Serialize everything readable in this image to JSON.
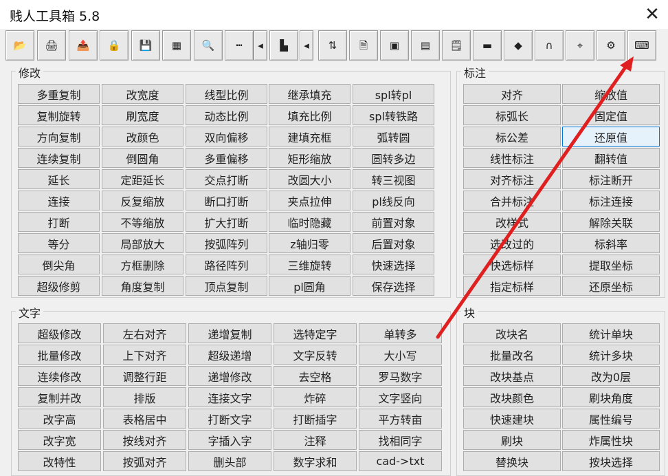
{
  "window": {
    "title": "贱人工具箱 5.8",
    "close_glyph": "✕"
  },
  "toolbar": {
    "icons": [
      "open-folder-icon",
      "printer-icon",
      "export-icon",
      "lock-icon",
      "save-icon",
      "table-icon",
      "magnifier-icon",
      "dashed-line-icon",
      "arrow-left-icon",
      "3d-block-icon",
      "arrow-left-icon",
      "layer-move-icon",
      "file-convert-icon",
      "image-icon",
      "color-palette-icon",
      "document-icon",
      "layer-icon",
      "cube-icon",
      "curve-icon",
      "point-icon",
      "settings-icon",
      "keyboard-icon"
    ],
    "glyphs": [
      "📂",
      "🖨",
      "📤",
      "🔒",
      "💾",
      "▦",
      "🔍",
      "┅",
      "◂",
      "▙",
      "◂",
      "⇅",
      "🗎",
      "▣",
      "▤",
      "🗒",
      "▬",
      "◆",
      "∩",
      "⌖",
      "⚙",
      "⌨"
    ]
  },
  "modify": {
    "title": "修改",
    "rows": [
      [
        "多重复制",
        "改宽度",
        "线型比例",
        "继承填充",
        "spl转pl"
      ],
      [
        "复制旋转",
        "刷宽度",
        "动态比例",
        "填充比例",
        "spl转铁路"
      ],
      [
        "方向复制",
        "改颜色",
        "双向偏移",
        "建填充框",
        "弧转圆"
      ],
      [
        "连续复制",
        "倒圆角",
        "多重偏移",
        "矩形缩放",
        "圆转多边"
      ],
      [
        "延长",
        "定距延长",
        "交点打断",
        "改圆大小",
        "转三视图"
      ],
      [
        "连接",
        "反复缩放",
        "断口打断",
        "夹点拉伸",
        "pl线反向"
      ],
      [
        "打断",
        "不等缩放",
        "扩大打断",
        "临时隐藏",
        "前置对象"
      ],
      [
        "等分",
        "局部放大",
        "按弧阵列",
        "z轴归零",
        "后置对象"
      ],
      [
        "倒尖角",
        "方框删除",
        "路径阵列",
        "三维旋转",
        "快速选择"
      ],
      [
        "超级修剪",
        "角度复制",
        "顶点复制",
        "pl圆角",
        "保存选择"
      ]
    ]
  },
  "dimension": {
    "title": "标注",
    "rows": [
      [
        "对齐",
        "缩放值"
      ],
      [
        "标弧长",
        "固定值"
      ],
      [
        "标公差",
        "还原值"
      ],
      [
        "线性标注",
        "翻转值"
      ],
      [
        "对齐标注",
        "标注断开"
      ],
      [
        "合并标注",
        "标注连接"
      ],
      [
        "改样式",
        "解除关联"
      ],
      [
        "选改过的",
        "标斜率"
      ],
      [
        "快选标样",
        "提取坐标"
      ],
      [
        "指定标样",
        "还原坐标"
      ]
    ]
  },
  "text": {
    "title": "文字",
    "rows": [
      [
        "超级修改",
        "左右对齐",
        "递增复制",
        "选特定字",
        "单转多"
      ],
      [
        "批量修改",
        "上下对齐",
        "超级递增",
        "文字反转",
        "大小写"
      ],
      [
        "连续修改",
        "调整行距",
        "递增修改",
        "去空格",
        "罗马数字"
      ],
      [
        "复制并改",
        "排版",
        "连接文字",
        "炸碎",
        "文字竖向"
      ],
      [
        "改字高",
        "表格居中",
        "打断文字",
        "打断插字",
        "平方转亩"
      ],
      [
        "改字宽",
        "按线对齐",
        "字插入字",
        "注释",
        "找相同字"
      ],
      [
        "改特性",
        "按弧对齐",
        "删头部",
        "数字求和",
        "cad->txt"
      ]
    ]
  },
  "block": {
    "title": "块",
    "rows": [
      [
        "改块名",
        "统计单块"
      ],
      [
        "批量改名",
        "统计多块"
      ],
      [
        "改块基点",
        "改为0层"
      ],
      [
        "改块颜色",
        "刷块角度"
      ],
      [
        "快速建块",
        "属性编号"
      ],
      [
        "刷块",
        "炸属性块"
      ],
      [
        "替换块",
        "按块选择"
      ]
    ]
  },
  "selected_cell": "还原值",
  "colors": {
    "accent": "#0078d7",
    "annotation_arrow": "#e02020"
  }
}
